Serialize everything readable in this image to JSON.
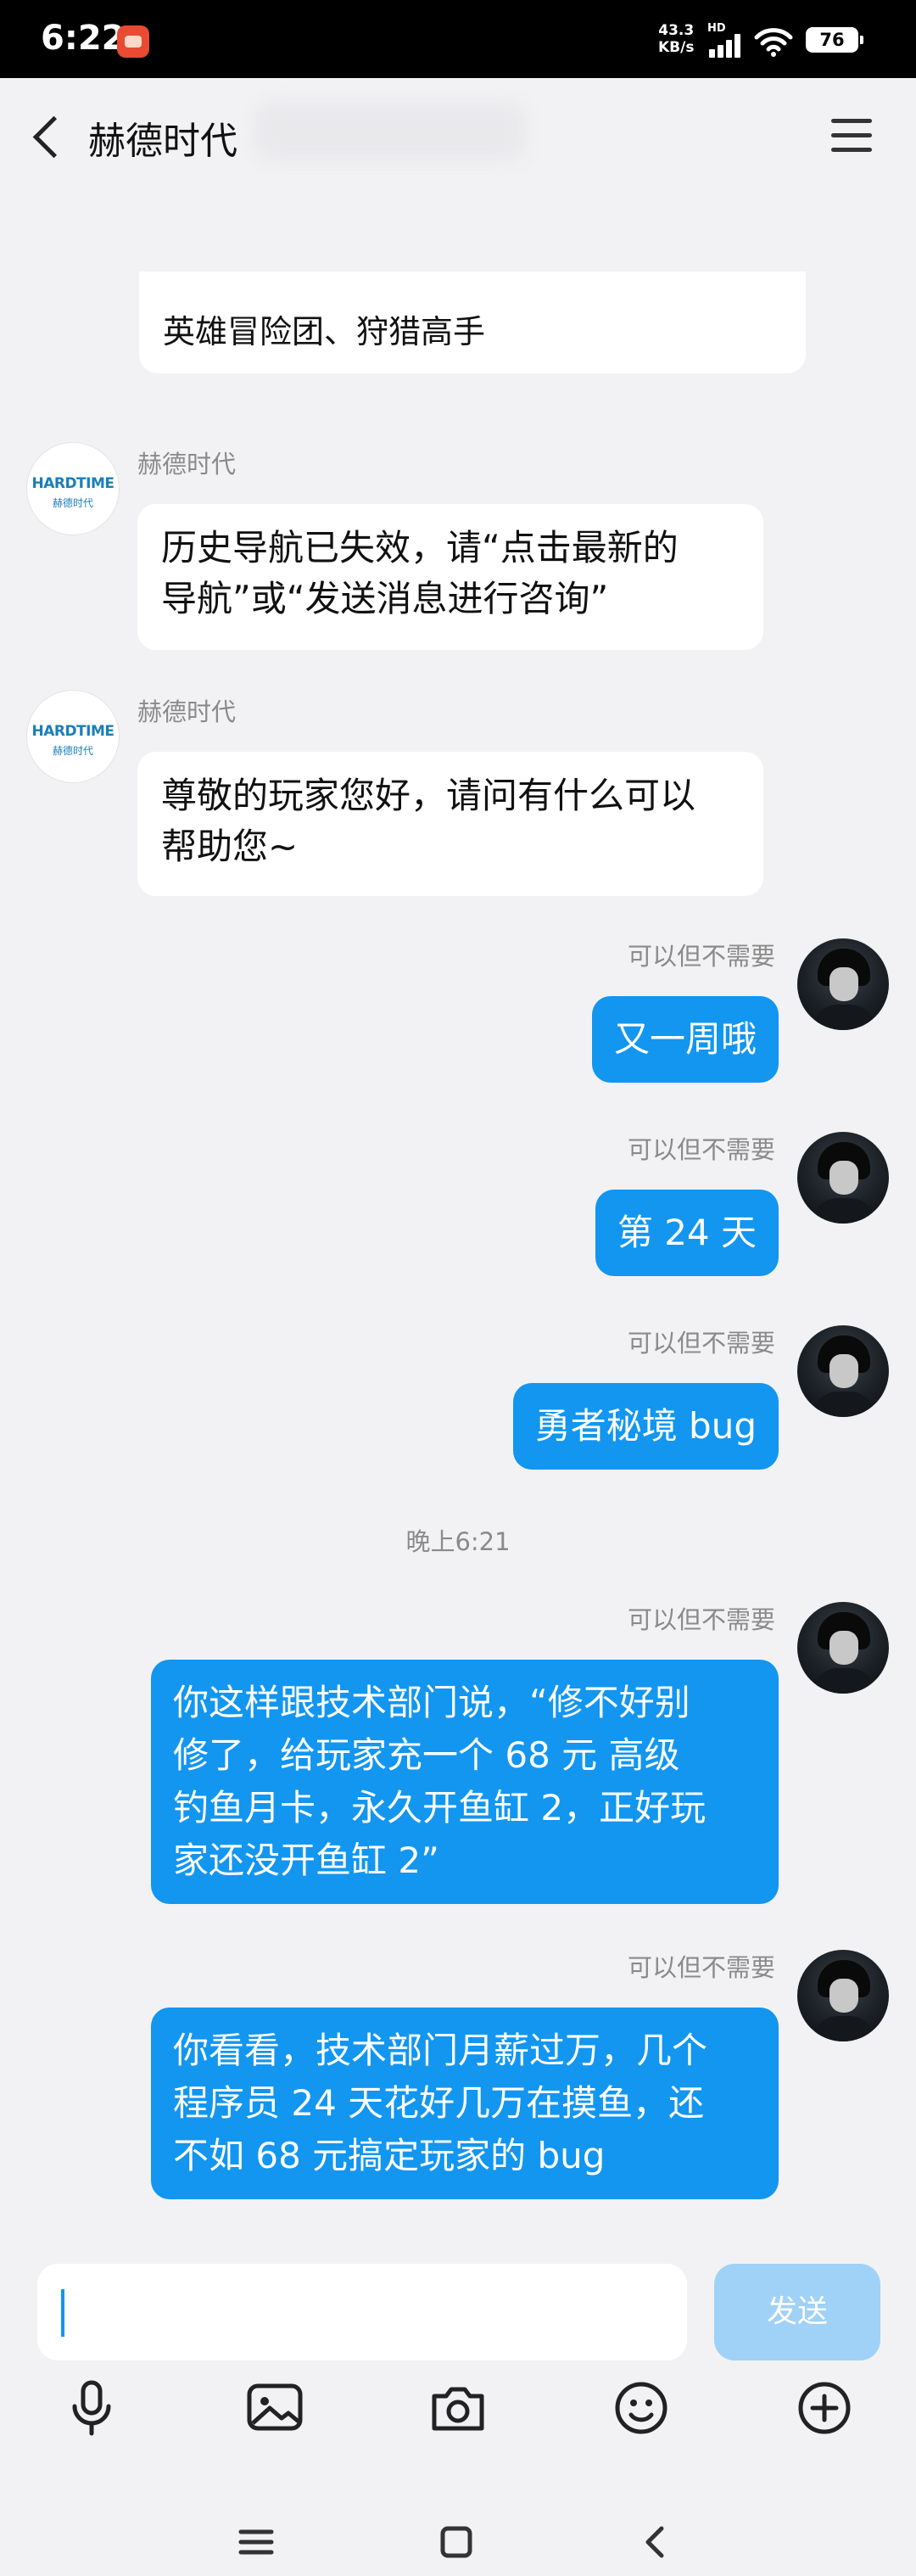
{
  "status_bar": {
    "time": "6:22",
    "net_speed": "43.3",
    "net_unit": "KB/s",
    "hd": "HD",
    "battery": "76"
  },
  "header": {
    "title": "赫德时代"
  },
  "chat": {
    "partial_bubble_text": "英雄冒险团、狩猎高手",
    "brand": {
      "logo_text": "HARDTIME",
      "logo_sub": "赫德时代"
    },
    "incoming": [
      {
        "sender": "赫德时代",
        "lines": [
          "历史导航已失效，请“点击最新的",
          "导航”或“发送消息进行咨询”"
        ]
      },
      {
        "sender": "赫德时代",
        "lines": [
          "尊敬的玩家您好，请问有什么可以",
          "帮助您~"
        ]
      }
    ],
    "outgoing": [
      {
        "sender": "可以但不需要",
        "text": "又一周哦"
      },
      {
        "sender": "可以但不需要",
        "text": "第 24 天"
      },
      {
        "sender": "可以但不需要",
        "text": "勇者秘境 bug"
      },
      {
        "sender": "可以但不需要",
        "text": "你这样跟技术部门说，“修不好别\n修了，给玩家充一个 68 元 高级\n钓鱼月卡，永久开鱼缸 2，正好玩\n家还没开鱼缸 2”"
      },
      {
        "sender": "可以但不需要",
        "text": "你看看，技术部门月薪过万，几个\n程序员 24 天花好几万在摸鱼，还\n不如 68 元搞定玩家的 bug"
      }
    ],
    "time_divider": "晚上6:21"
  },
  "input": {
    "value": "",
    "send_label": "发送"
  },
  "toolbar": {
    "icons": [
      "microphone-icon",
      "image-icon",
      "camera-icon",
      "emoji-icon",
      "plus-icon"
    ]
  },
  "colors": {
    "outgoing_bubble": "#1296f0",
    "send_disabled": "#9fd2f6",
    "brand": "#1a7fb8"
  }
}
